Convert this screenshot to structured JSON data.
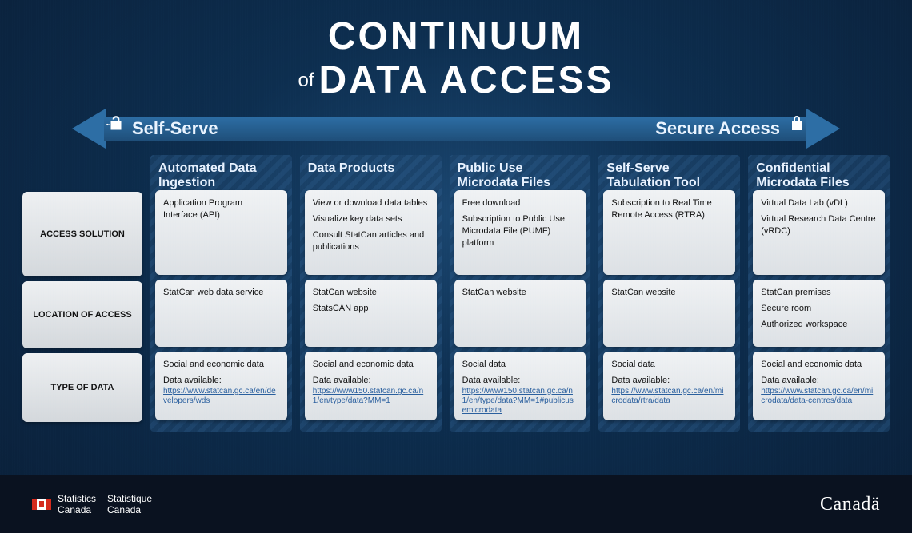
{
  "title": {
    "line1": "CONTINUUM",
    "of": "of",
    "line2": "DATA ACCESS"
  },
  "arrow": {
    "left": "Self-Serve",
    "right": "Secure Access"
  },
  "rowLabels": [
    "ACCESS SOLUTION",
    "LOCATION OF ACCESS",
    "TYPE OF DATA"
  ],
  "columns": [
    {
      "head": "Automated Data Ingestion",
      "access": [
        "Application Program Interface (API)"
      ],
      "location": [
        "StatCan web data service"
      ],
      "type": {
        "desc": "Social and economic data",
        "avail": "Data available:",
        "link": "https://www.statcan.gc.ca/en/developers/wds"
      }
    },
    {
      "head": "Data Products",
      "access": [
        "View or download data tables",
        "Visualize key data sets",
        "Consult StatCan articles and publications"
      ],
      "location": [
        "StatCan website",
        "StatsCAN app"
      ],
      "type": {
        "desc": "Social and economic data",
        "avail": "Data available:",
        "link": "https://www150.statcan.gc.ca/n1/en/type/data?MM=1"
      }
    },
    {
      "head": "Public Use Microdata Files",
      "access": [
        "Free download",
        "Subscription to Public Use Microdata File (PUMF) platform"
      ],
      "location": [
        "StatCan website"
      ],
      "type": {
        "desc": "Social data",
        "avail": "Data available:",
        "link": "https://www150.statcan.gc.ca/n1/en/type/data?MM=1#publicusemicrodata"
      }
    },
    {
      "head": "Self-Serve Tabulation Tool",
      "access": [
        "Subscription to Real Time Remote Access (RTRA)"
      ],
      "location": [
        "StatCan website"
      ],
      "type": {
        "desc": "Social data",
        "avail": "Data available:",
        "link": "https://www.statcan.gc.ca/en/microdata/rtra/data"
      }
    },
    {
      "head": "Confidential Microdata Files",
      "access": [
        "Virtual Data Lab (vDL)",
        "Virtual Research Data Centre (vRDC)"
      ],
      "location": [
        "StatCan premises",
        "Secure room",
        "Authorized workspace"
      ],
      "type": {
        "desc": "Social and economic data",
        "avail": "Data available:",
        "link": "https://www.statcan.gc.ca/en/microdata/data-centres/data"
      }
    }
  ],
  "footer": {
    "en": "Statistics\nCanada",
    "fr": "Statistique\nCanada",
    "wordmark": "Canadä"
  }
}
